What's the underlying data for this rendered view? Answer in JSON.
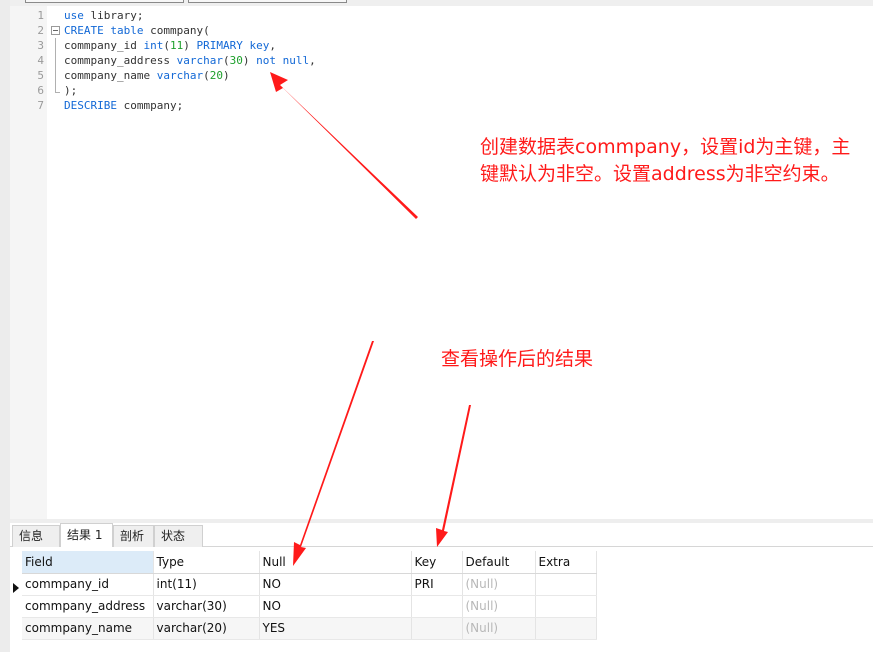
{
  "editor": {
    "lines": [
      {
        "no": "1",
        "tokens": [
          {
            "t": "kw",
            "v": "use"
          },
          {
            "t": "id",
            "v": " library;"
          }
        ]
      },
      {
        "no": "2",
        "tokens": [
          {
            "t": "kw",
            "v": "CREATE"
          },
          {
            "t": "id",
            "v": " "
          },
          {
            "t": "kw",
            "v": "table"
          },
          {
            "t": "id",
            "v": " commpany("
          }
        ]
      },
      {
        "no": "3",
        "tokens": [
          {
            "t": "id",
            "v": "commpany_id "
          },
          {
            "t": "kw",
            "v": "int"
          },
          {
            "t": "id",
            "v": "("
          },
          {
            "t": "num",
            "v": "11"
          },
          {
            "t": "id",
            "v": ") "
          },
          {
            "t": "kw",
            "v": "PRIMARY"
          },
          {
            "t": "id",
            "v": " "
          },
          {
            "t": "kw",
            "v": "key"
          },
          {
            "t": "id",
            "v": ","
          }
        ]
      },
      {
        "no": "4",
        "tokens": [
          {
            "t": "id",
            "v": "commpany_address "
          },
          {
            "t": "kw",
            "v": "varchar"
          },
          {
            "t": "id",
            "v": "("
          },
          {
            "t": "num",
            "v": "30"
          },
          {
            "t": "id",
            "v": ") "
          },
          {
            "t": "kw",
            "v": "not"
          },
          {
            "t": "id",
            "v": " "
          },
          {
            "t": "kw",
            "v": "null"
          },
          {
            "t": "id",
            "v": ","
          }
        ]
      },
      {
        "no": "5",
        "tokens": [
          {
            "t": "id",
            "v": "commpany_name "
          },
          {
            "t": "kw",
            "v": "varchar"
          },
          {
            "t": "id",
            "v": "("
          },
          {
            "t": "num",
            "v": "20"
          },
          {
            "t": "id",
            "v": ")"
          }
        ]
      },
      {
        "no": "6",
        "tokens": [
          {
            "t": "id",
            "v": ");"
          }
        ]
      },
      {
        "no": "7",
        "tokens": [
          {
            "t": "kw",
            "v": "DESCRIBE"
          },
          {
            "t": "id",
            "v": " commpany;"
          }
        ]
      }
    ]
  },
  "annotations": {
    "note1": "创建数据表commpany，设置id为主键，主键默认为非空。设置address为非空约束。",
    "note2": "查看操作后的结果",
    "color": "#ff1a1a"
  },
  "result_tabs": [
    {
      "label": "信息",
      "active": false
    },
    {
      "label": "结果 1",
      "active": true
    },
    {
      "label": "剖析",
      "active": false
    },
    {
      "label": "状态",
      "active": false
    }
  ],
  "result_grid": {
    "columns": [
      "Field",
      "Type",
      "Null",
      "Key",
      "Default",
      "Extra"
    ],
    "rows": [
      [
        "commpany_id",
        "int(11)",
        "NO",
        "PRI",
        "(Null)",
        ""
      ],
      [
        "commpany_address",
        "varchar(30)",
        "NO",
        "",
        "(Null)",
        ""
      ],
      [
        "commpany_name",
        "varchar(20)",
        "YES",
        "",
        "(Null)",
        ""
      ]
    ],
    "current_row": 0
  }
}
